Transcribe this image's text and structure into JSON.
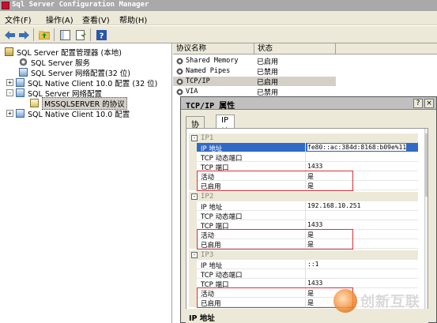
{
  "window": {
    "title": "Sql Server Configuration Manager"
  },
  "menu": [
    "文件(F)",
    "操作(A)",
    "查看(V)",
    "帮助(H)"
  ],
  "toolbar": {
    "icons": [
      "back-arrow-icon",
      "forward-arrow-icon",
      "up-folder-icon",
      "show-tree-icon",
      "export-icon",
      "help-icon"
    ]
  },
  "tree": {
    "items": [
      {
        "label": "SQL Server 配置管理器 (本地)",
        "icon": "server-config-icon",
        "expander": ""
      },
      {
        "label": "SQL Server 服务",
        "icon": "services-icon",
        "expander": ""
      },
      {
        "label": "SQL Server 网络配置(32 位)",
        "icon": "network-icon",
        "expander": ""
      },
      {
        "label": "SQL Native Client 10.0 配置 (32 位)",
        "icon": "client-icon",
        "expander": "+"
      },
      {
        "label": "SQL Server 网络配置",
        "icon": "network-icon",
        "expander": "-"
      },
      {
        "label": "MSSQLSERVER 的协议",
        "icon": "protocol-icon",
        "expander": ""
      },
      {
        "label": "SQL Native Client 10.0 配置",
        "icon": "client-icon",
        "expander": "+"
      }
    ]
  },
  "list": {
    "columns": [
      "协议名称",
      "状态"
    ],
    "rows": [
      {
        "name": "Shared Memory",
        "status": "已启用"
      },
      {
        "name": "Named Pipes",
        "status": "已禁用"
      },
      {
        "name": "TCP/IP",
        "status": "已启用"
      },
      {
        "name": "VIA",
        "status": "已禁用"
      }
    ]
  },
  "dialog": {
    "title": "TCP/IP 属性",
    "help_btn": "?",
    "close_btn": "×",
    "tabs": [
      "协议",
      "IP 地址"
    ],
    "groups": [
      {
        "name": "IP1",
        "props": [
          {
            "name": "IP 地址",
            "value": "fe80::ac:384d:8168:b09e%11"
          },
          {
            "name": "TCP 动态端口",
            "value": ""
          },
          {
            "name": "TCP 端口",
            "value": "1433"
          },
          {
            "name": "活动",
            "value": "是"
          },
          {
            "name": "已启用",
            "value": "是"
          }
        ]
      },
      {
        "name": "IP2",
        "props": [
          {
            "name": "IP 地址",
            "value": "192.168.10.251"
          },
          {
            "name": "TCP 动态端口",
            "value": ""
          },
          {
            "name": "TCP 端口",
            "value": "1433"
          },
          {
            "name": "活动",
            "value": "是"
          },
          {
            "name": "已启用",
            "value": "是"
          }
        ]
      },
      {
        "name": "IP3",
        "props": [
          {
            "name": "IP 地址",
            "value": "::1"
          },
          {
            "name": "TCP 动态端口",
            "value": ""
          },
          {
            "name": "TCP 端口",
            "value": "1433"
          },
          {
            "name": "活动",
            "value": "是"
          },
          {
            "name": "已启用",
            "value": "是"
          }
        ]
      }
    ],
    "description": "IP 地址"
  },
  "watermark": {
    "text": "创新互联"
  },
  "colors": {
    "highlight_box": "#e0303a",
    "selection": "#316ac5"
  }
}
